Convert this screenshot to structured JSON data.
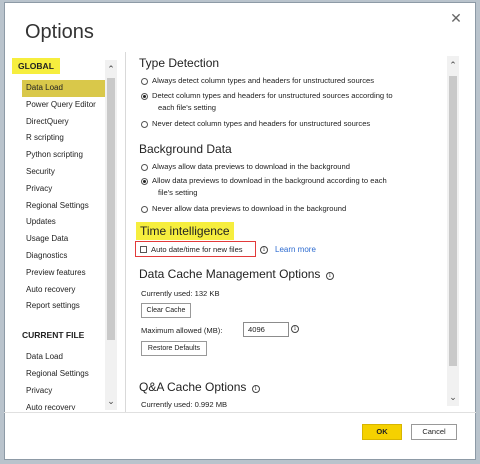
{
  "dialog": {
    "title": "Options",
    "close_glyph": "✕"
  },
  "nav": {
    "global_label": "GLOBAL",
    "global_items": [
      "Data Load",
      "Power Query Editor",
      "DirectQuery",
      "R scripting",
      "Python scripting",
      "Security",
      "Privacy",
      "Regional Settings",
      "Updates",
      "Usage Data",
      "Diagnostics",
      "Preview features",
      "Auto recovery",
      "Report settings"
    ],
    "current_label": "CURRENT FILE",
    "current_items": [
      "Data Load",
      "Regional Settings",
      "Privacy",
      "Auto recovery"
    ]
  },
  "type_detection": {
    "heading": "Type Detection",
    "options": [
      {
        "l1": "Always detect column types and headers for unstructured sources",
        "l2": "",
        "selected": false
      },
      {
        "l1": "Detect column types and headers for unstructured sources according to",
        "l2": "each file's setting",
        "selected": true
      },
      {
        "l1": "Never detect column types and headers for unstructured sources",
        "l2": "",
        "selected": false
      }
    ]
  },
  "background_data": {
    "heading": "Background Data",
    "options": [
      {
        "l1": "Always allow data previews to download in the background",
        "l2": "",
        "selected": false
      },
      {
        "l1": "Allow data previews to download in the background according to each",
        "l2": "file's setting",
        "selected": true
      },
      {
        "l1": "Never allow data previews to download in the background",
        "l2": "",
        "selected": false
      }
    ]
  },
  "time_intelligence": {
    "heading": "Time intelligence",
    "checkbox_label": "Auto date/time for new files",
    "checked": false,
    "learn_more": "Learn more"
  },
  "data_cache": {
    "heading": "Data Cache Management Options",
    "currently_used": "Currently used: 132 KB",
    "clear_cache": "Clear Cache",
    "max_allowed_label": "Maximum allowed (MB):",
    "max_allowed_value": "4096",
    "restore_defaults": "Restore Defaults"
  },
  "qa_cache": {
    "heading": "Q&A Cache Options",
    "currently_used": "Currently used: 0.992 MB"
  },
  "footer": {
    "ok": "OK",
    "cancel": "Cancel"
  },
  "colors": {
    "highlight_yellow": "#f6ee3e",
    "selected_nav": "#d9c84a",
    "ok_button": "#f5d100",
    "focus_red": "#e23a3a",
    "link": "#2d6bd0"
  }
}
